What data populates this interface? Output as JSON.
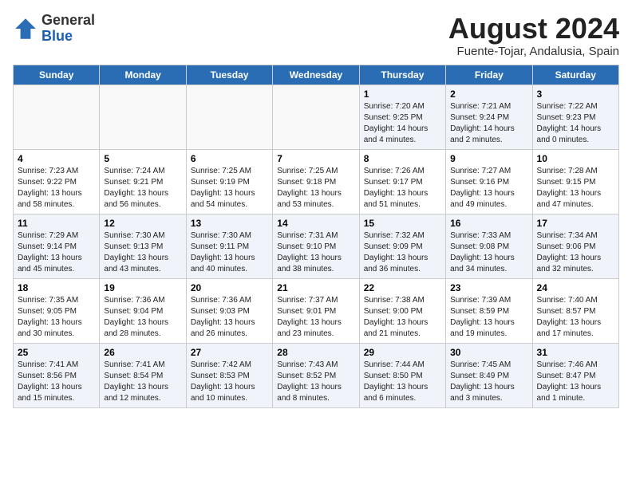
{
  "header": {
    "logo_general": "General",
    "logo_blue": "Blue",
    "month_year": "August 2024",
    "location": "Fuente-Tojar, Andalusia, Spain"
  },
  "days_of_week": [
    "Sunday",
    "Monday",
    "Tuesday",
    "Wednesday",
    "Thursday",
    "Friday",
    "Saturday"
  ],
  "weeks": [
    [
      {
        "day": "",
        "info": ""
      },
      {
        "day": "",
        "info": ""
      },
      {
        "day": "",
        "info": ""
      },
      {
        "day": "",
        "info": ""
      },
      {
        "day": "1",
        "info": "Sunrise: 7:20 AM\nSunset: 9:25 PM\nDaylight: 14 hours\nand 4 minutes."
      },
      {
        "day": "2",
        "info": "Sunrise: 7:21 AM\nSunset: 9:24 PM\nDaylight: 14 hours\nand 2 minutes."
      },
      {
        "day": "3",
        "info": "Sunrise: 7:22 AM\nSunset: 9:23 PM\nDaylight: 14 hours\nand 0 minutes."
      }
    ],
    [
      {
        "day": "4",
        "info": "Sunrise: 7:23 AM\nSunset: 9:22 PM\nDaylight: 13 hours\nand 58 minutes."
      },
      {
        "day": "5",
        "info": "Sunrise: 7:24 AM\nSunset: 9:21 PM\nDaylight: 13 hours\nand 56 minutes."
      },
      {
        "day": "6",
        "info": "Sunrise: 7:25 AM\nSunset: 9:19 PM\nDaylight: 13 hours\nand 54 minutes."
      },
      {
        "day": "7",
        "info": "Sunrise: 7:25 AM\nSunset: 9:18 PM\nDaylight: 13 hours\nand 53 minutes."
      },
      {
        "day": "8",
        "info": "Sunrise: 7:26 AM\nSunset: 9:17 PM\nDaylight: 13 hours\nand 51 minutes."
      },
      {
        "day": "9",
        "info": "Sunrise: 7:27 AM\nSunset: 9:16 PM\nDaylight: 13 hours\nand 49 minutes."
      },
      {
        "day": "10",
        "info": "Sunrise: 7:28 AM\nSunset: 9:15 PM\nDaylight: 13 hours\nand 47 minutes."
      }
    ],
    [
      {
        "day": "11",
        "info": "Sunrise: 7:29 AM\nSunset: 9:14 PM\nDaylight: 13 hours\nand 45 minutes."
      },
      {
        "day": "12",
        "info": "Sunrise: 7:30 AM\nSunset: 9:13 PM\nDaylight: 13 hours\nand 43 minutes."
      },
      {
        "day": "13",
        "info": "Sunrise: 7:30 AM\nSunset: 9:11 PM\nDaylight: 13 hours\nand 40 minutes."
      },
      {
        "day": "14",
        "info": "Sunrise: 7:31 AM\nSunset: 9:10 PM\nDaylight: 13 hours\nand 38 minutes."
      },
      {
        "day": "15",
        "info": "Sunrise: 7:32 AM\nSunset: 9:09 PM\nDaylight: 13 hours\nand 36 minutes."
      },
      {
        "day": "16",
        "info": "Sunrise: 7:33 AM\nSunset: 9:08 PM\nDaylight: 13 hours\nand 34 minutes."
      },
      {
        "day": "17",
        "info": "Sunrise: 7:34 AM\nSunset: 9:06 PM\nDaylight: 13 hours\nand 32 minutes."
      }
    ],
    [
      {
        "day": "18",
        "info": "Sunrise: 7:35 AM\nSunset: 9:05 PM\nDaylight: 13 hours\nand 30 minutes."
      },
      {
        "day": "19",
        "info": "Sunrise: 7:36 AM\nSunset: 9:04 PM\nDaylight: 13 hours\nand 28 minutes."
      },
      {
        "day": "20",
        "info": "Sunrise: 7:36 AM\nSunset: 9:03 PM\nDaylight: 13 hours\nand 26 minutes."
      },
      {
        "day": "21",
        "info": "Sunrise: 7:37 AM\nSunset: 9:01 PM\nDaylight: 13 hours\nand 23 minutes."
      },
      {
        "day": "22",
        "info": "Sunrise: 7:38 AM\nSunset: 9:00 PM\nDaylight: 13 hours\nand 21 minutes."
      },
      {
        "day": "23",
        "info": "Sunrise: 7:39 AM\nSunset: 8:59 PM\nDaylight: 13 hours\nand 19 minutes."
      },
      {
        "day": "24",
        "info": "Sunrise: 7:40 AM\nSunset: 8:57 PM\nDaylight: 13 hours\nand 17 minutes."
      }
    ],
    [
      {
        "day": "25",
        "info": "Sunrise: 7:41 AM\nSunset: 8:56 PM\nDaylight: 13 hours\nand 15 minutes."
      },
      {
        "day": "26",
        "info": "Sunrise: 7:41 AM\nSunset: 8:54 PM\nDaylight: 13 hours\nand 12 minutes."
      },
      {
        "day": "27",
        "info": "Sunrise: 7:42 AM\nSunset: 8:53 PM\nDaylight: 13 hours\nand 10 minutes."
      },
      {
        "day": "28",
        "info": "Sunrise: 7:43 AM\nSunset: 8:52 PM\nDaylight: 13 hours\nand 8 minutes."
      },
      {
        "day": "29",
        "info": "Sunrise: 7:44 AM\nSunset: 8:50 PM\nDaylight: 13 hours\nand 6 minutes."
      },
      {
        "day": "30",
        "info": "Sunrise: 7:45 AM\nSunset: 8:49 PM\nDaylight: 13 hours\nand 3 minutes."
      },
      {
        "day": "31",
        "info": "Sunrise: 7:46 AM\nSunset: 8:47 PM\nDaylight: 13 hours\nand 1 minute."
      }
    ]
  ]
}
